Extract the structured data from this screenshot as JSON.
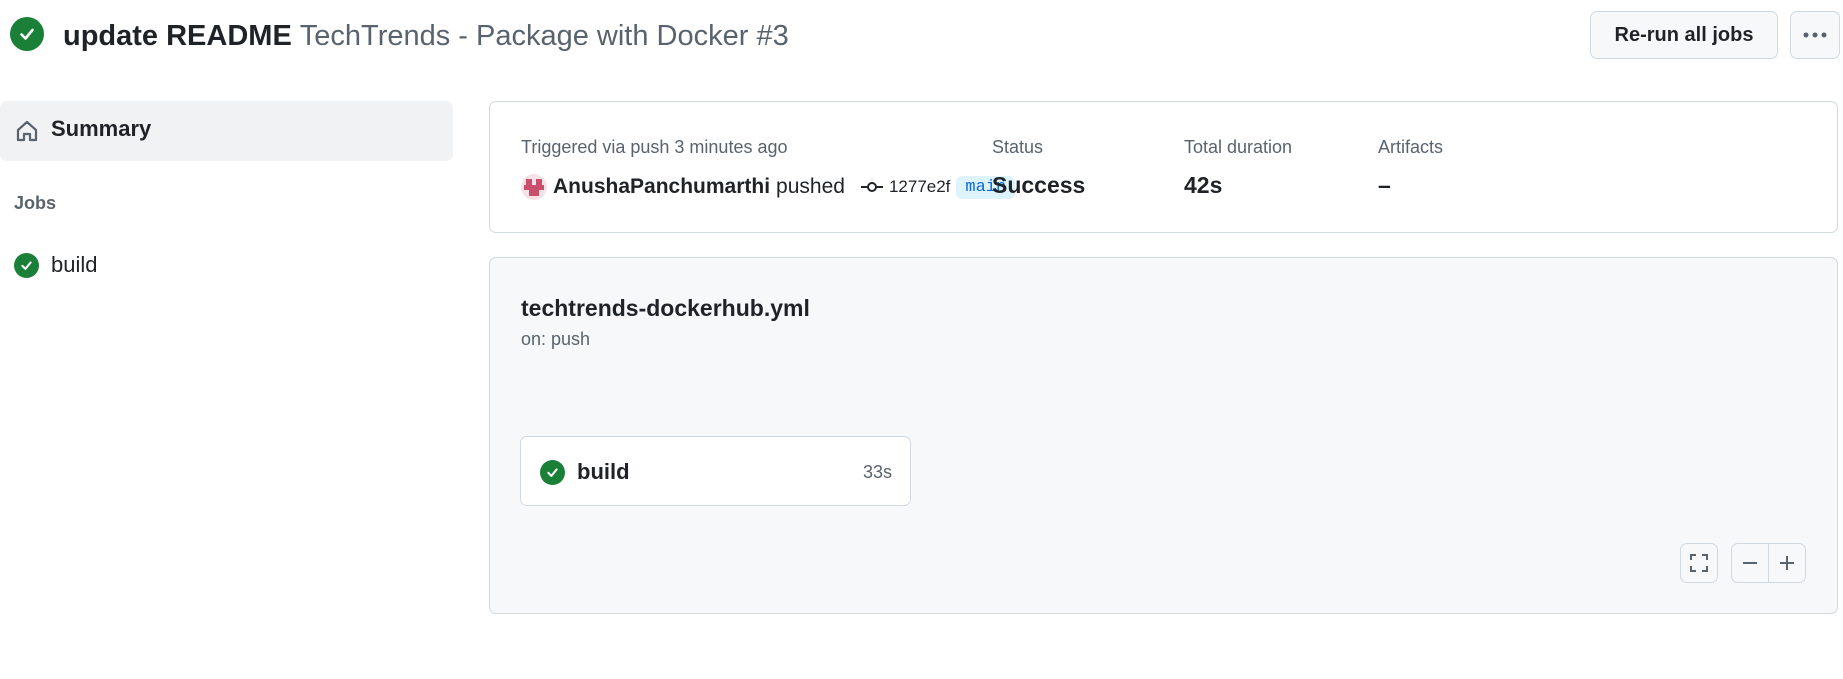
{
  "header": {
    "commit_message": "update README",
    "workflow_run": "TechTrends - Package with Docker #3",
    "rerun_label": "Re-run all jobs",
    "more_icon": "kebab-horizontal-icon",
    "status_icon": "check-circle-icon"
  },
  "sidebar": {
    "summary_label": "Summary",
    "summary_icon": "home-icon",
    "jobs_heading": "Jobs",
    "jobs": [
      {
        "label": "build",
        "status": "success"
      }
    ]
  },
  "summary": {
    "triggered_text": "Triggered via push 3 minutes ago",
    "actor": "AnushaPanchumarthi",
    "action": "pushed",
    "commit_sha": "1277e2f",
    "branch": "main",
    "status_label": "Status",
    "status_value": "Success",
    "duration_label": "Total duration",
    "duration_value": "42s",
    "artifacts_label": "Artifacts",
    "artifacts_value": "–"
  },
  "graph": {
    "workflow_file": "techtrends-dockerhub.yml",
    "trigger": "on: push",
    "jobs": [
      {
        "name": "build",
        "duration": "33s",
        "status": "success"
      }
    ],
    "controls": [
      "fullscreen-icon",
      "zoom-out-icon",
      "zoom-in-icon"
    ]
  },
  "colors": {
    "success": "#1a7f37",
    "accent": "#0969da",
    "muted": "#59636e",
    "border": "#d1d9e0",
    "canvas_subtle": "#f6f8fa"
  }
}
